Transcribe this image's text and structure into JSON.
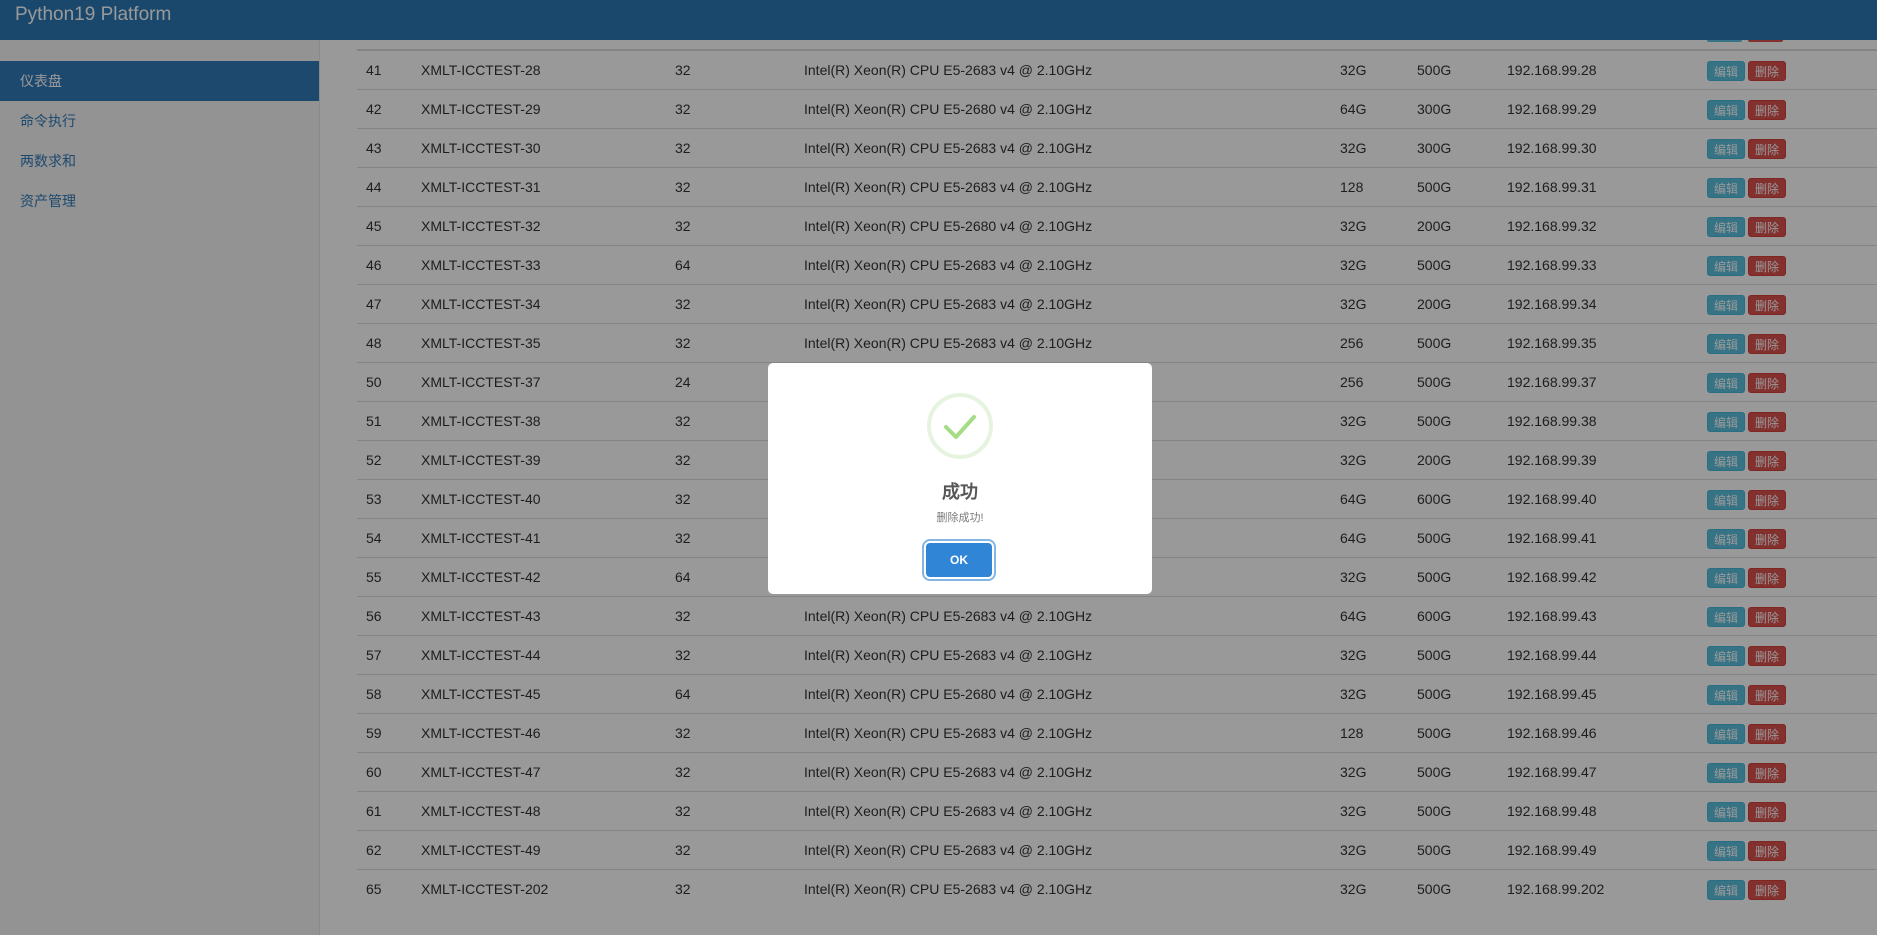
{
  "app": {
    "title": "Python19 Platform"
  },
  "sidebar": {
    "items": [
      {
        "label": "仪表盘",
        "active": true
      },
      {
        "label": "命令执行",
        "active": false
      },
      {
        "label": "两数求和",
        "active": false
      },
      {
        "label": "资产管理",
        "active": false
      }
    ]
  },
  "table": {
    "edit_label": "编辑",
    "delete_label": "删除",
    "rows": [
      {
        "id": "41",
        "hostname": "XMLT-ICCTEST-28",
        "cores": "32",
        "cpu": "Intel(R) Xeon(R) CPU E5-2683 v4 @ 2.10GHz",
        "memory": "32G",
        "disk": "500G",
        "ip": "192.168.99.28"
      },
      {
        "id": "42",
        "hostname": "XMLT-ICCTEST-29",
        "cores": "32",
        "cpu": "Intel(R) Xeon(R) CPU E5-2680 v4 @ 2.10GHz",
        "memory": "64G",
        "disk": "300G",
        "ip": "192.168.99.29"
      },
      {
        "id": "43",
        "hostname": "XMLT-ICCTEST-30",
        "cores": "32",
        "cpu": "Intel(R) Xeon(R) CPU E5-2683 v4 @ 2.10GHz",
        "memory": "32G",
        "disk": "300G",
        "ip": "192.168.99.30"
      },
      {
        "id": "44",
        "hostname": "XMLT-ICCTEST-31",
        "cores": "32",
        "cpu": "Intel(R) Xeon(R) CPU E5-2683 v4 @ 2.10GHz",
        "memory": "128",
        "disk": "500G",
        "ip": "192.168.99.31"
      },
      {
        "id": "45",
        "hostname": "XMLT-ICCTEST-32",
        "cores": "32",
        "cpu": "Intel(R) Xeon(R) CPU E5-2680 v4 @ 2.10GHz",
        "memory": "32G",
        "disk": "200G",
        "ip": "192.168.99.32"
      },
      {
        "id": "46",
        "hostname": "XMLT-ICCTEST-33",
        "cores": "64",
        "cpu": "Intel(R) Xeon(R) CPU E5-2683 v4 @ 2.10GHz",
        "memory": "32G",
        "disk": "500G",
        "ip": "192.168.99.33"
      },
      {
        "id": "47",
        "hostname": "XMLT-ICCTEST-34",
        "cores": "32",
        "cpu": "Intel(R) Xeon(R) CPU E5-2683 v4 @ 2.10GHz",
        "memory": "32G",
        "disk": "200G",
        "ip": "192.168.99.34"
      },
      {
        "id": "48",
        "hostname": "XMLT-ICCTEST-35",
        "cores": "32",
        "cpu": "Intel(R) Xeon(R) CPU E5-2683 v4 @ 2.10GHz",
        "memory": "256",
        "disk": "500G",
        "ip": "192.168.99.35"
      },
      {
        "id": "50",
        "hostname": "XMLT-ICCTEST-37",
        "cores": "24",
        "cpu": "",
        "memory": "256",
        "disk": "500G",
        "ip": "192.168.99.37"
      },
      {
        "id": "51",
        "hostname": "XMLT-ICCTEST-38",
        "cores": "32",
        "cpu": "",
        "memory": "32G",
        "disk": "500G",
        "ip": "192.168.99.38"
      },
      {
        "id": "52",
        "hostname": "XMLT-ICCTEST-39",
        "cores": "32",
        "cpu": "",
        "memory": "32G",
        "disk": "200G",
        "ip": "192.168.99.39"
      },
      {
        "id": "53",
        "hostname": "XMLT-ICCTEST-40",
        "cores": "32",
        "cpu": "",
        "memory": "64G",
        "disk": "600G",
        "ip": "192.168.99.40"
      },
      {
        "id": "54",
        "hostname": "XMLT-ICCTEST-41",
        "cores": "32",
        "cpu": "",
        "memory": "64G",
        "disk": "500G",
        "ip": "192.168.99.41"
      },
      {
        "id": "55",
        "hostname": "XMLT-ICCTEST-42",
        "cores": "64",
        "cpu": "",
        "memory": "32G",
        "disk": "500G",
        "ip": "192.168.99.42"
      },
      {
        "id": "56",
        "hostname": "XMLT-ICCTEST-43",
        "cores": "32",
        "cpu": "Intel(R) Xeon(R) CPU E5-2683 v4 @ 2.10GHz",
        "memory": "64G",
        "disk": "600G",
        "ip": "192.168.99.43"
      },
      {
        "id": "57",
        "hostname": "XMLT-ICCTEST-44",
        "cores": "32",
        "cpu": "Intel(R) Xeon(R) CPU E5-2683 v4 @ 2.10GHz",
        "memory": "32G",
        "disk": "500G",
        "ip": "192.168.99.44"
      },
      {
        "id": "58",
        "hostname": "XMLT-ICCTEST-45",
        "cores": "64",
        "cpu": "Intel(R) Xeon(R) CPU E5-2680 v4 @ 2.10GHz",
        "memory": "32G",
        "disk": "500G",
        "ip": "192.168.99.45"
      },
      {
        "id": "59",
        "hostname": "XMLT-ICCTEST-46",
        "cores": "32",
        "cpu": "Intel(R) Xeon(R) CPU E5-2683 v4 @ 2.10GHz",
        "memory": "128",
        "disk": "500G",
        "ip": "192.168.99.46"
      },
      {
        "id": "60",
        "hostname": "XMLT-ICCTEST-47",
        "cores": "32",
        "cpu": "Intel(R) Xeon(R) CPU E5-2683 v4 @ 2.10GHz",
        "memory": "32G",
        "disk": "500G",
        "ip": "192.168.99.47"
      },
      {
        "id": "61",
        "hostname": "XMLT-ICCTEST-48",
        "cores": "32",
        "cpu": "Intel(R) Xeon(R) CPU E5-2683 v4 @ 2.10GHz",
        "memory": "32G",
        "disk": "500G",
        "ip": "192.168.99.48"
      },
      {
        "id": "62",
        "hostname": "XMLT-ICCTEST-49",
        "cores": "32",
        "cpu": "Intel(R) Xeon(R) CPU E5-2683 v4 @ 2.10GHz",
        "memory": "32G",
        "disk": "500G",
        "ip": "192.168.99.49"
      },
      {
        "id": "65",
        "hostname": "XMLT-ICCTEST-202",
        "cores": "32",
        "cpu": "Intel(R) Xeon(R) CPU E5-2683 v4 @ 2.10GHz",
        "memory": "32G",
        "disk": "500G",
        "ip": "192.168.99.202"
      }
    ]
  },
  "modal": {
    "icon": "check-icon",
    "title": "成功",
    "text": "删除成功!",
    "ok_label": "OK"
  },
  "colors": {
    "header": "#2b78b4",
    "sidebar_active": "#337ab7",
    "edit_button": "#5bc0de",
    "delete_button": "#d9534f",
    "ok_button": "#3085d6",
    "success": "#a5dc86"
  }
}
